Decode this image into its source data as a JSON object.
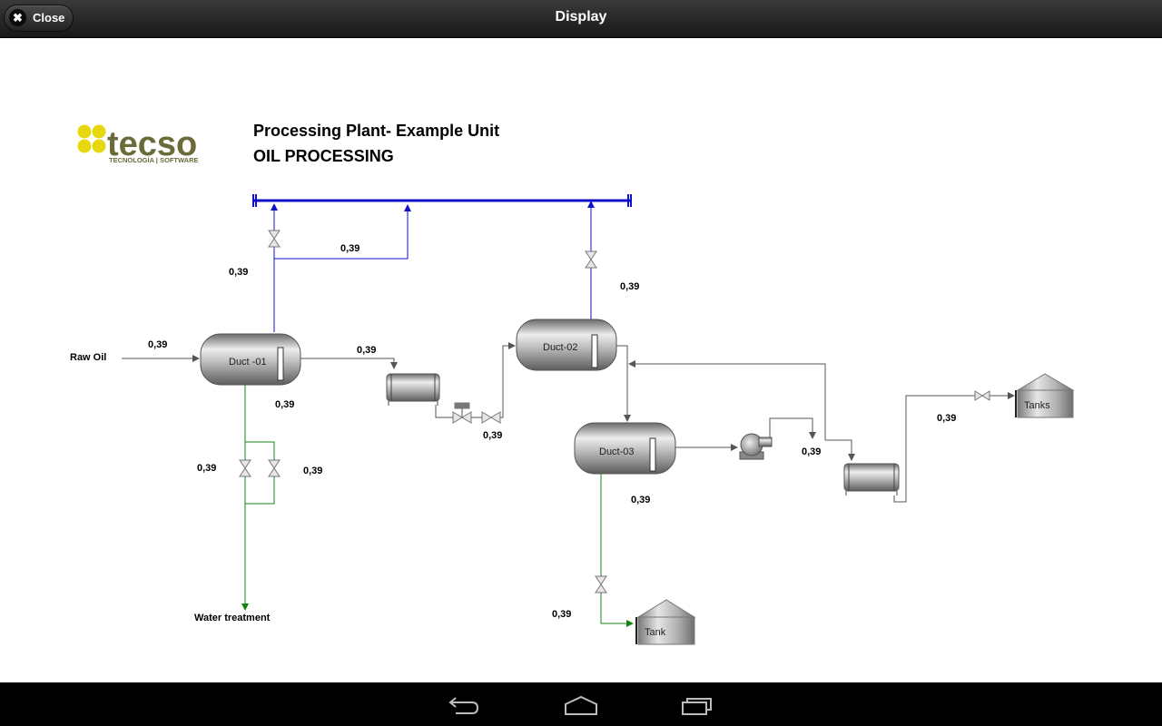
{
  "header": {
    "close_label": "Close",
    "title": "Display"
  },
  "logo": {
    "name": "tecso",
    "tagline": "TECNOLOGÍA | SOFTWARE",
    "color": "#6b6b3a",
    "dot_color": "#e6d80f"
  },
  "page": {
    "title": "Processing Plant- Example Unit",
    "subtitle": "OIL PROCESSING"
  },
  "labels": {
    "raw_oil": "Raw Oil",
    "water_treatment": "Water treatment"
  },
  "equipment": {
    "duct1": "Duct -01",
    "duct2": "Duct-02",
    "duct3": "Duct-03",
    "tank": "Tank",
    "tanks": "Tanks"
  },
  "readings": {
    "raw_oil_flow": "0,39",
    "gas_valve1": "0,39",
    "gas_branch": "0,39",
    "gas_valve2": "0,39",
    "duct1_out": "0,39",
    "duct1_level": "0,39",
    "water_left": "0,39",
    "water_right": "0,39",
    "valve_mid": "0,39",
    "duct3_level": "0,39",
    "pump_out": "0,39",
    "tanks_line": "0,39",
    "tank_line": "0,39"
  },
  "colors": {
    "gas_line": "#1010c8",
    "water_line": "#148214",
    "process_line": "#555555"
  },
  "navbar": {
    "icons": [
      "back-icon",
      "home-icon",
      "recent-apps-icon"
    ]
  }
}
